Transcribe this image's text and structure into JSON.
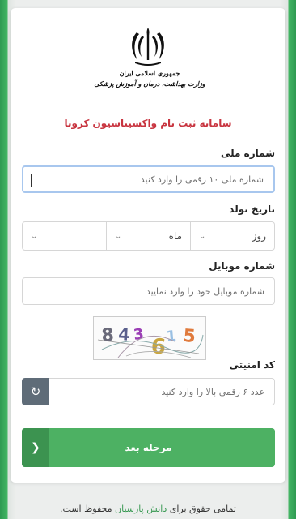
{
  "header": {
    "emblem_line1": "جمهوری اسلامی ایران",
    "emblem_line2": "وزارت بهداشت، درمان و آموزش پزشکی",
    "title": "سامانه ثبت نام واکسیناسیون کرونا"
  },
  "national_id": {
    "label": "شماره ملی",
    "placeholder": "شماره ملی ۱۰ رقمی را وارد کنید"
  },
  "birth_date": {
    "label": "تاریخ تولد",
    "day": "روز",
    "month": "ماه",
    "year": ""
  },
  "mobile": {
    "label": "شماره موبایل",
    "placeholder": "شماره موبایل خود را وارد نمایید"
  },
  "captcha": {
    "text": "843615",
    "chars": [
      {
        "ch": "8",
        "color": "#6a6a7a"
      },
      {
        "ch": "4",
        "color": "#5a5f8c"
      },
      {
        "ch": "3",
        "color": "#9b3fb5"
      },
      {
        "ch": "6",
        "color": "#c9a640"
      },
      {
        "ch": "1",
        "color": "#9ac0e3"
      },
      {
        "ch": "5",
        "color": "#e07a3c"
      }
    ]
  },
  "security_code": {
    "label": "کد امنیتی",
    "placeholder": "عدد ۶ رقمی بالا را وارد کنید"
  },
  "next_button": {
    "label": "مرحله بعد"
  },
  "footer": {
    "prefix": "تمامی حقوق برای",
    "link": "دانش پارسیان",
    "suffix": "محفوظ است."
  },
  "colors": {
    "accent_green": "#4db163",
    "title_red": "#c8343f",
    "refresh_gray": "#5f6c78"
  }
}
